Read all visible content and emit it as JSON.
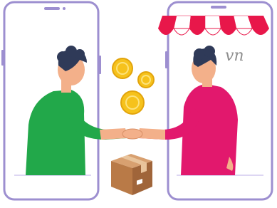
{
  "illustration": {
    "logo_text": "vn",
    "colors": {
      "phone_outline": "#9d8fd0",
      "phone_fill": "#ffffff",
      "awning_red": "#e8174a",
      "awning_white": "#ffffff",
      "buyer_shirt": "#22a84a",
      "seller_shirt": "#e2186d",
      "skin": "#f3b08a",
      "hair": "#2f3a58",
      "coin": "#f6c21c",
      "box": "#b97a47",
      "floor_line": "#ddd6f3"
    },
    "icons": [
      "phone-left",
      "phone-right",
      "shop-awning",
      "coins",
      "handshake",
      "parcel-box"
    ]
  }
}
